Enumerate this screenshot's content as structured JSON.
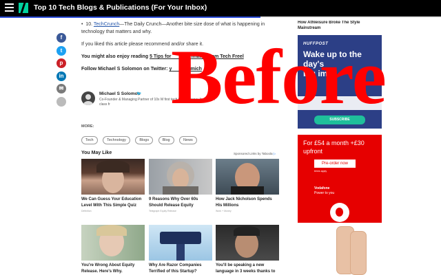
{
  "topbar": {
    "title": "Top 10 Tech Blogs & Publications (For Your Inbox)",
    "progress": 0.59,
    "progress_color": "#2b4cd8",
    "logo_color": "#00d29f"
  },
  "share": {
    "icons": [
      "facebook-icon",
      "twitter-icon",
      "pinterest-icon",
      "linkedin-icon",
      "email-icon",
      "comment-icon"
    ],
    "glyphs": [
      "f",
      "t",
      "p",
      "in",
      "✉",
      ""
    ]
  },
  "article": {
    "item_prefix": "10.",
    "item_link": "TechCrunch",
    "item_text": "—The Daily Crunch—Another bite size dose of what is happening in technology that matters and why.",
    "recommend": "If you liked this article please recommend and/or share it.",
    "enjoy_prefix": "You might also enjoy reading",
    "enjoy_link": "5 Tips for",
    "enjoy_link_tail": "imates from Tech Freel",
    "follow_prefix": "Follow Michael S Solomon on Twitter:",
    "follow_link_start": "y",
    "follow_link_tail": "mich"
  },
  "author": {
    "name": "Michael S Solomon",
    "bio": "Co-Founder & Managing Partner of 10x M first tech talent agency for best in class fr"
  },
  "more": {
    "label": "MORE:",
    "tags": [
      "Tech",
      "Technology",
      "Blogs",
      "Blog",
      "News"
    ]
  },
  "you_may_like": {
    "heading": "You May Like",
    "sponsored": "Sponsored Links by Taboola",
    "cards": [
      {
        "title": "We Can Guess Your Education Level With This Simple Quiz",
        "source": "Definition"
      },
      {
        "title": "9 Reasons Why Over 60s Should Release Equity",
        "source": "Telegraph Equity Release"
      },
      {
        "title": "How Jack Nicholson Spends His Millions",
        "source": "Work + Money"
      },
      {
        "title": "You're Wrong About Equity Release. Here's Why.",
        "source": ""
      },
      {
        "title": "Why Are Razor Companies Terrified of this Startup?",
        "source": ""
      },
      {
        "title": "You'll be speaking a new language in 3 weeks thanks to",
        "source": ""
      }
    ]
  },
  "ads": {
    "right_top_line1": "How Athleisure Broke The Style",
    "right_top_line2": "Mainstream",
    "huffpost_brand": "HUFFPOST",
    "huffpost_headline": "Wake up to the day's",
    "huffpost_headline2": "big imp",
    "huffpost_cta": "SUBSCRIBE",
    "voda_price": "For £54 a month +£30 upfront",
    "voda_cta": "Pre-order now",
    "voda_small": "terms apply",
    "voda_brand": "Vodafone",
    "voda_tagline": "Power to you",
    "voda_color": "#e60000"
  },
  "watermark": {
    "text": "Before",
    "color": "#ff0000"
  }
}
